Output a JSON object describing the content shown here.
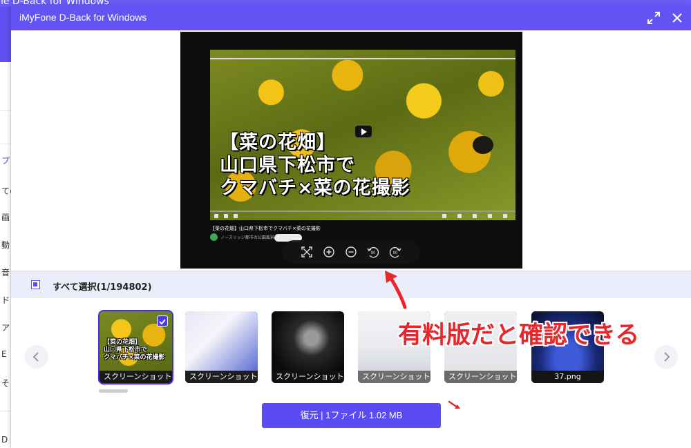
{
  "background_app": {
    "title": "ne D-Back for Windows",
    "sidebar_items": [
      "プ",
      "ての",
      "画",
      "動",
      "音",
      "ド",
      "ア",
      "E",
      "そ",
      "D"
    ]
  },
  "modal": {
    "title": "iMyFone D-Back for Windows",
    "accent_color": "#6253f2",
    "titlebar_icons": [
      "expand-icon",
      "close-icon"
    ]
  },
  "preview": {
    "video_caption": "【菜の花畑】\n山口県下松市で\nクマバチ×菜の花撮影",
    "video_page_title": "【菜の花畑】山口県下松市でクマバチ×菜の花撮影",
    "channel_name": "ノースリッジ都市の公園風景",
    "zoom_controls": [
      "fit-screen-icon",
      "zoom-in-icon",
      "zoom-out-icon",
      "rotate-left-90-icon",
      "rotate-right-90-icon"
    ],
    "rotate_left_label": "90",
    "rotate_right_label": "90"
  },
  "selection": {
    "select_all_label": "すべて選択(1/194802)"
  },
  "thumbnails": [
    {
      "label": "スクリーンショット ...",
      "selected": true
    },
    {
      "label": "スクリーンショット ...",
      "selected": false
    },
    {
      "label": "スクリーンショット ...",
      "selected": false
    },
    {
      "label": "スクリーンショット ...",
      "selected": false
    },
    {
      "label": "スクリーンショット ...",
      "selected": false
    },
    {
      "label": "37.png",
      "selected": false
    }
  ],
  "restore_button": {
    "label": "復元 | 1ファイル  1.02 MB"
  },
  "annotation": {
    "text": "有料版だと確認できる",
    "color": "#e8262b"
  }
}
